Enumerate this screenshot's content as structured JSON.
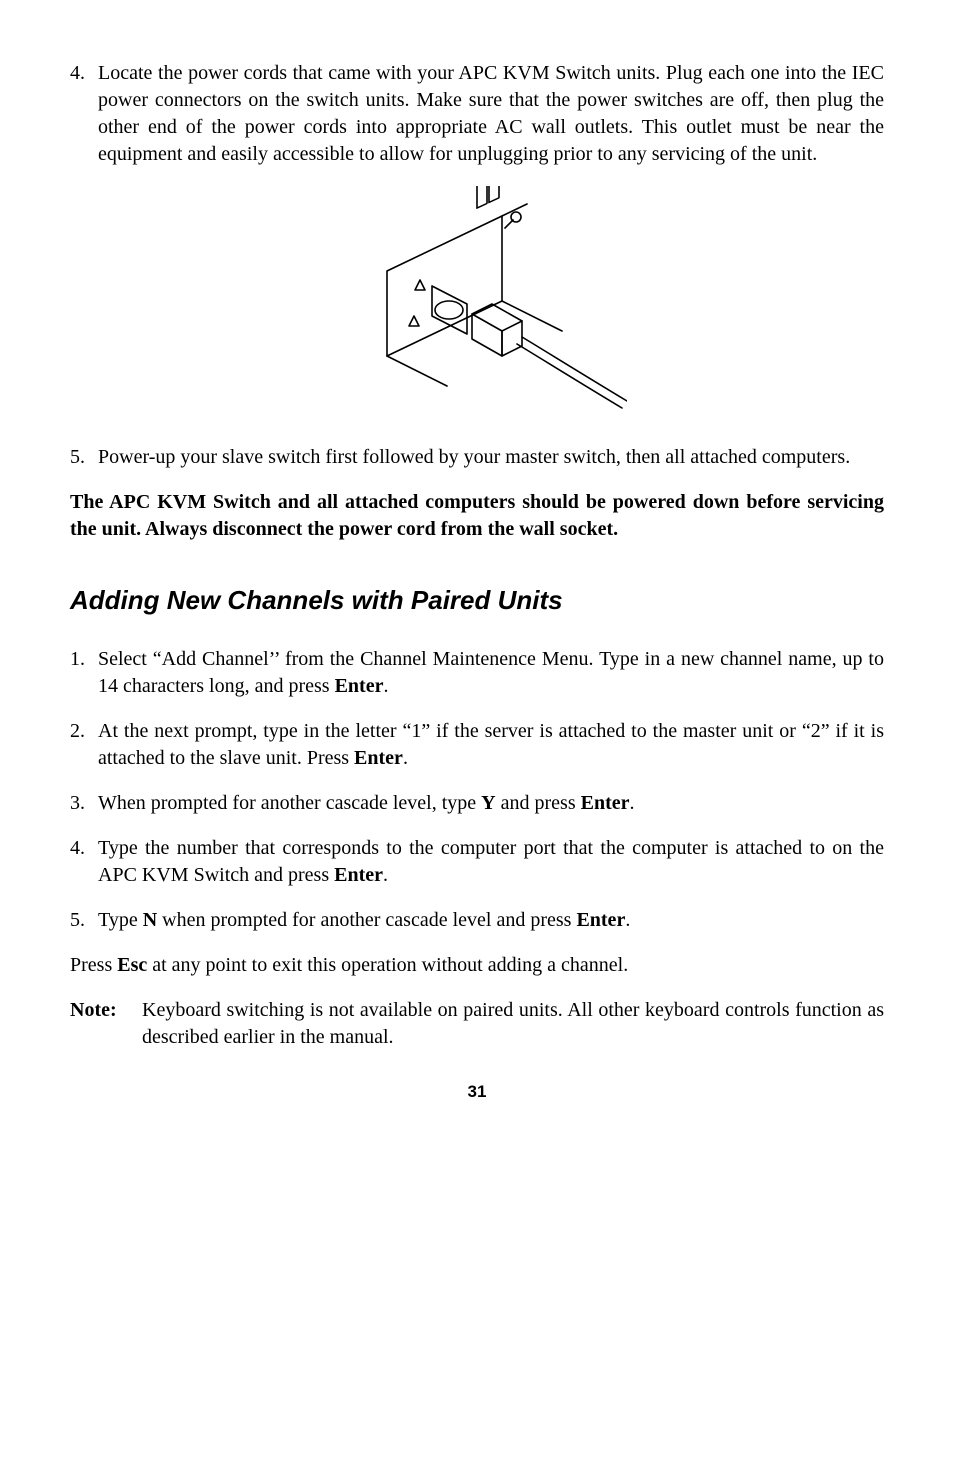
{
  "list1": {
    "item4": {
      "num": "4.",
      "text": "Locate the power cords that came with your APC KVM Switch units. Plug each one into the IEC power connectors on the switch units. Make sure that the power switches are off, then plug the other end of the power cords into appropriate AC wall outlets. This outlet must be near the equipment and easily accessible to allow for unplugging prior to any servicing of the unit."
    },
    "item5": {
      "num": "5.",
      "text": "Power-up your slave switch first followed by your master switch, then all attached computers."
    }
  },
  "bold_warning": "The APC KVM Switch and all attached computers should be powered down before servicing the unit. Always disconnect the power cord from the wall socket.",
  "section_heading": "Adding New Channels with Paired Units",
  "list2": {
    "item1": {
      "num": "1.",
      "pre": "Select “Add Channel’’ from the Channel Maintenence Menu. Type in a new channel name, up to 14 characters long, and press ",
      "b1": "Enter",
      "post": "."
    },
    "item2": {
      "num": "2.",
      "pre": "At the next prompt, type in the letter “1” if the server is attached to the master unit or “2” if it is attached to the slave unit. Press ",
      "b1": "Enter",
      "post": "."
    },
    "item3": {
      "num": "3.",
      "pre": "When prompted for another cascade level, type ",
      "b1": "Y",
      "mid": " and press ",
      "b2": "Enter",
      "post": "."
    },
    "item4": {
      "num": "4.",
      "pre": "Type the number that corresponds to the computer port that the computer is attached to on the APC KVM Switch and press ",
      "b1": "Enter",
      "post": "."
    },
    "item5": {
      "num": "5.",
      "pre": "Type ",
      "b1": "N",
      "mid": " when prompted for another cascade level and press ",
      "b2": "Enter",
      "post": "."
    }
  },
  "esc_para": {
    "pre": "Press ",
    "b1": "Esc",
    "post": " at any point to exit this operation without adding a channel."
  },
  "note": {
    "label": "Note:",
    "text": "Keyboard switching is not available on paired units. All other keyboard controls function as described earlier in the manual."
  },
  "page_number": "31"
}
